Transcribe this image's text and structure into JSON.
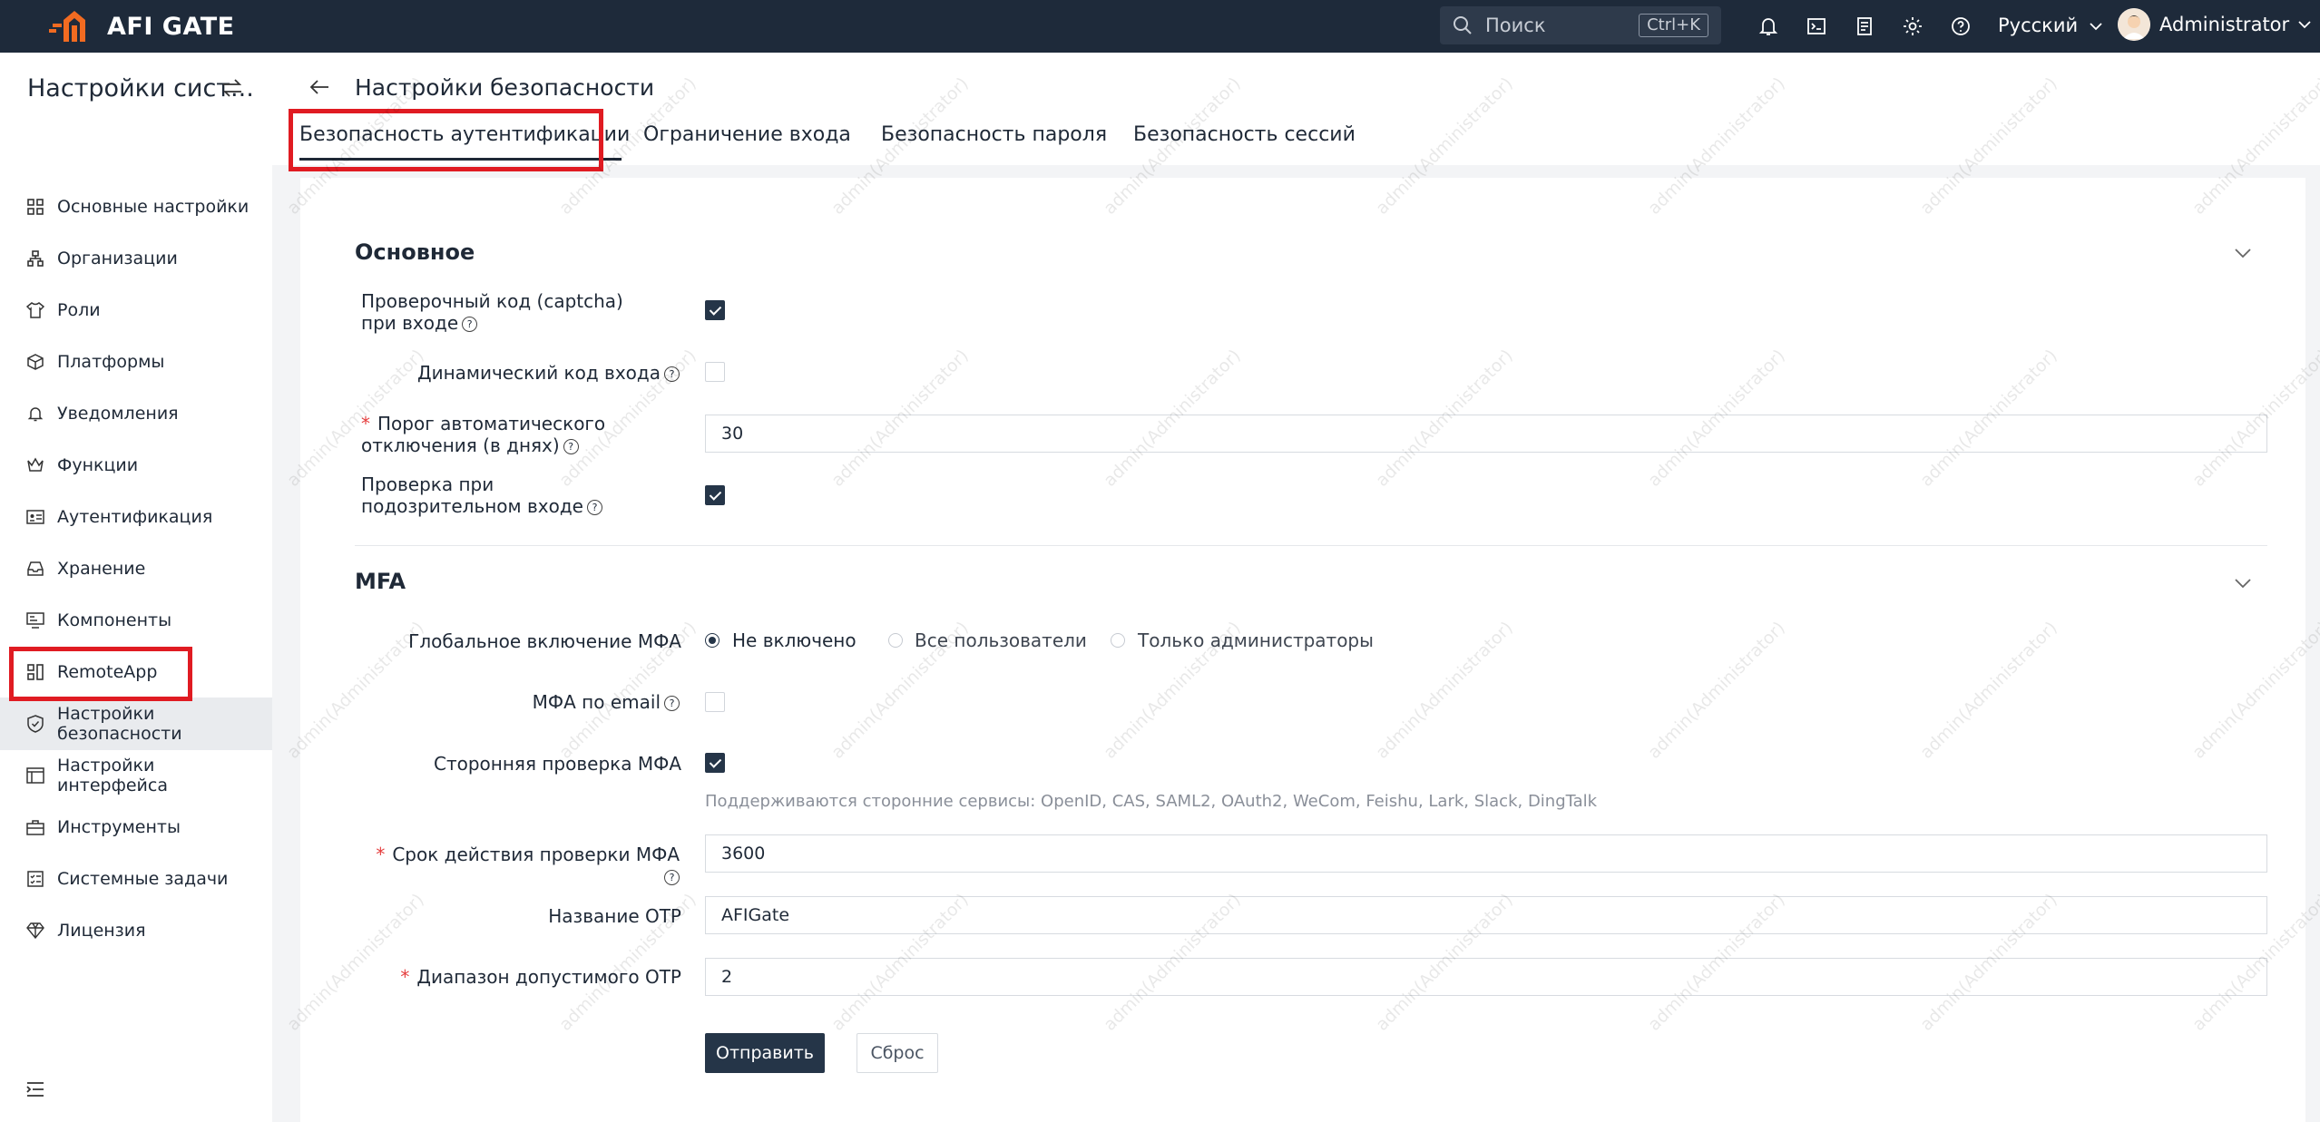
{
  "app": {
    "logo_text": "AFI GATE"
  },
  "topbar": {
    "search_placeholder": "Поиск",
    "search_shortcut": "Ctrl+K",
    "language": "Русский",
    "user_name": "Administrator"
  },
  "sidebar": {
    "title": "Настройки сист...",
    "items": [
      {
        "label": "Основные настройки",
        "icon": "grid-icon"
      },
      {
        "label": "Организации",
        "icon": "org-icon"
      },
      {
        "label": "Роли",
        "icon": "shirt-icon"
      },
      {
        "label": "Платформы",
        "icon": "cube-icon"
      },
      {
        "label": "Уведомления",
        "icon": "bell-icon"
      },
      {
        "label": "Функции",
        "icon": "crown-icon"
      },
      {
        "label": "Аутентификация",
        "icon": "id-card-icon"
      },
      {
        "label": "Хранение",
        "icon": "inbox-icon"
      },
      {
        "label": "Компоненты",
        "icon": "monitor-icon"
      },
      {
        "label": "RemoteApp",
        "icon": "apps-icon"
      },
      {
        "label": "Настройки безопасности",
        "icon": "shield-icon",
        "active": true
      },
      {
        "label": "Настройки интерфейса",
        "icon": "layout-icon"
      },
      {
        "label": "Инструменты",
        "icon": "toolbox-icon"
      },
      {
        "label": "Системные задачи",
        "icon": "tasks-icon"
      },
      {
        "label": "Лицензия",
        "icon": "diamond-icon"
      }
    ]
  },
  "page": {
    "title": "Настройки безопасности",
    "tabs": [
      {
        "label": "Безопасность аутентификации",
        "active": true
      },
      {
        "label": "Ограничение входа"
      },
      {
        "label": "Безопасность пароля"
      },
      {
        "label": "Безопасность сессий"
      }
    ]
  },
  "basic": {
    "title": "Основное",
    "captcha_label": "Проверочный код (captcha) при входе",
    "captcha_checked": true,
    "dynamic_code_label": "Динамический код входа",
    "dynamic_code_checked": false,
    "auto_disable_label": "Порог автоматического отключения (в днях)",
    "auto_disable_value": "30",
    "suspicious_label": "Проверка при подозрительном входе",
    "suspicious_checked": true
  },
  "mfa": {
    "title": "MFA",
    "global_label": "Глобальное включение МФА",
    "global_options": [
      "Не включено",
      "Все пользователи",
      "Только администраторы"
    ],
    "global_selected": "Не включено",
    "email_label": "МФА по email",
    "email_checked": false,
    "third_party_label": "Сторонняя проверка МФА",
    "third_party_checked": true,
    "third_party_hint": "Поддерживаются сторонние сервисы: OpenID, CAS, SAML2, OAuth2, WeCom, Feishu, Lark, Slack, DingTalk",
    "expiry_label": "Срок действия проверки МФА",
    "expiry_value": "3600",
    "otp_name_label": "Название OTP",
    "otp_name_value": "AFIGate",
    "otp_range_label": "Диапазон допустимого OTP",
    "otp_range_value": "2"
  },
  "actions": {
    "submit": "Отправить",
    "reset": "Сброс"
  },
  "watermark": "admin(Administrator)",
  "colors": {
    "topbar": "#1e2a3a",
    "primary": "#253548",
    "highlight": "#e01b22",
    "logo": "#f26b21"
  }
}
